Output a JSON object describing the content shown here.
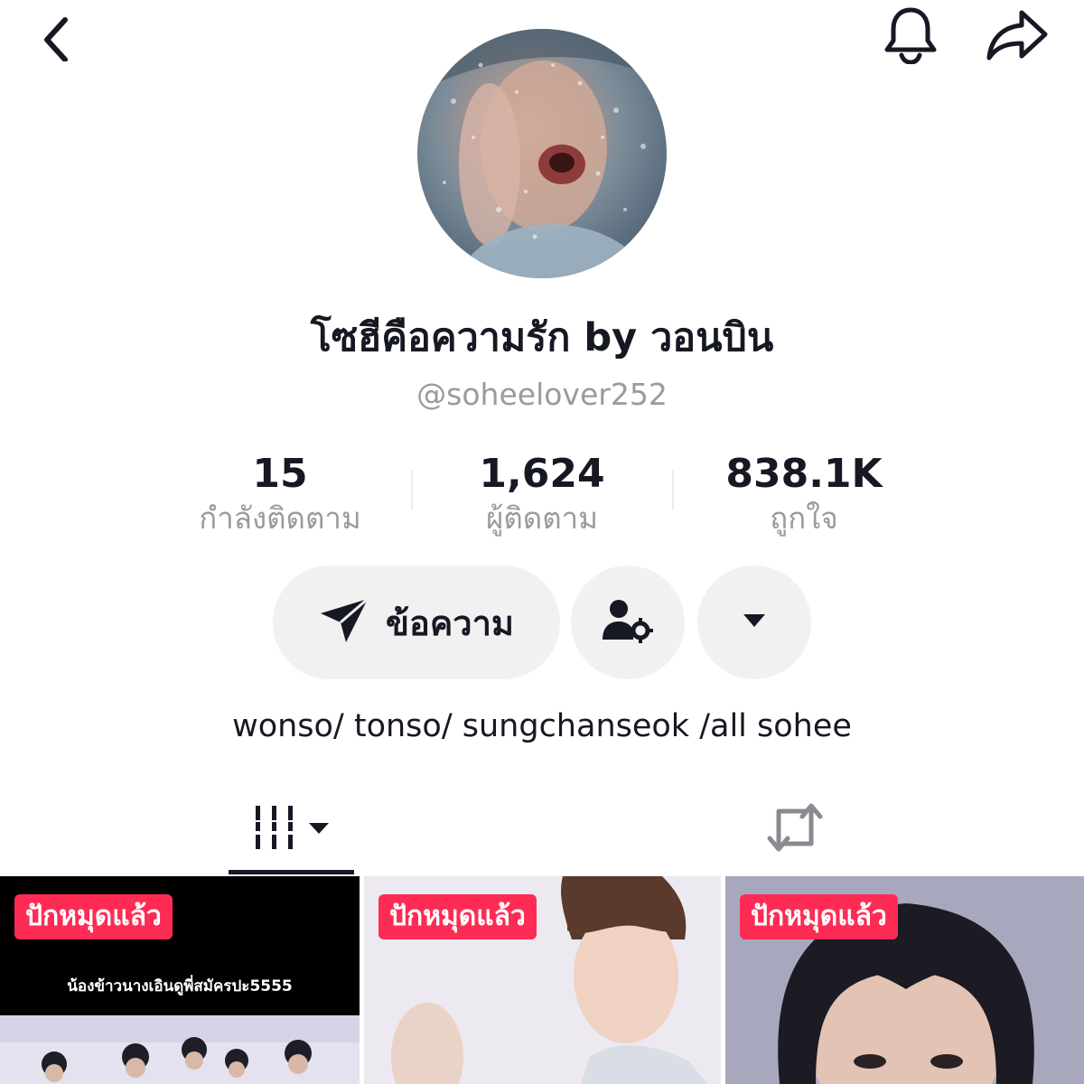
{
  "header": {
    "back_icon": "chevron-left-icon",
    "notification_icon": "bell-icon",
    "share_icon": "share-arrow-icon"
  },
  "profile": {
    "display_name": "โซฮีคือความรัก by วอนบิน",
    "username": "@soheelover252",
    "bio": "wonso/ tonso/ sungchanseok /all sohee"
  },
  "stats": {
    "following": {
      "value": "15",
      "label": "กำลังติดตาม"
    },
    "followers": {
      "value": "1,624",
      "label": "ผู้ติดตาม"
    },
    "likes": {
      "value": "838.1K",
      "label": "ถูกใจ"
    }
  },
  "actions": {
    "message_label": "ข้อความ",
    "message_icon": "send-icon",
    "friends_icon": "person-gear-icon",
    "more_icon": "caret-down-icon"
  },
  "tabs": {
    "videos_icon": "grid-bars-icon",
    "videos_dropdown_icon": "caret-down-icon",
    "reposts_icon": "repost-icon"
  },
  "videos": [
    {
      "badge": "ปักหมุดแล้ว",
      "caption": "น้องข้าวนางเอินดูพี่สมัครปะ5555"
    },
    {
      "badge": "ปักหมุดแล้ว"
    },
    {
      "badge": "ปักหมุดแล้ว"
    }
  ],
  "colors": {
    "accent": "#fe2c55",
    "text_primary": "#161823",
    "text_secondary": "#9a9a9f",
    "button_bg": "#f1f1f2"
  }
}
